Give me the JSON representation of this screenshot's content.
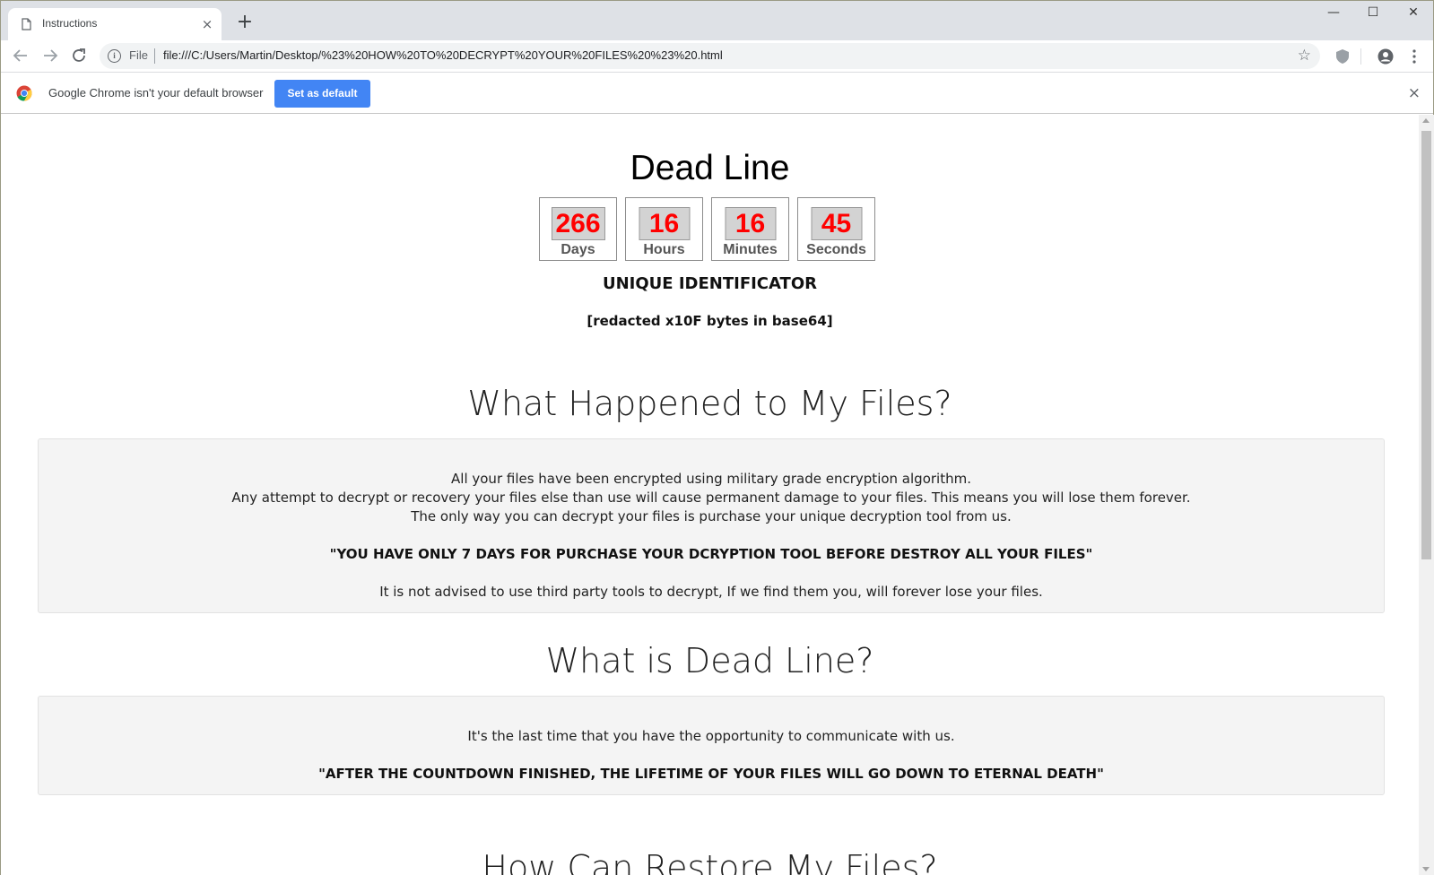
{
  "browser": {
    "tab_title": "Instructions",
    "tab_close": "×",
    "new_tab": "+",
    "window_controls": {
      "minimize": "—",
      "maximize": "☐",
      "close": "✕"
    },
    "omnibox": {
      "scheme_label": "File",
      "url": "file:///C:/Users/Martin/Desktop/%23%20HOW%20TO%20DECRYPT%20YOUR%20FILES%20%23%20.html"
    },
    "infobar": {
      "message": "Google Chrome isn't your default browser",
      "button_label": "Set as default",
      "close": "×"
    }
  },
  "page": {
    "title": "Dead Line",
    "countdown": [
      {
        "value": "266",
        "label": "Days"
      },
      {
        "value": "16",
        "label": "Hours"
      },
      {
        "value": "16",
        "label": "Minutes"
      },
      {
        "value": "45",
        "label": "Seconds"
      }
    ],
    "uid_title": "UNIQUE IDENTIFICATOR",
    "uid_value": "[redacted x10F bytes in base64]",
    "section1": {
      "heading": "What Happened to My Files?",
      "line1": "All your files have been encrypted using military grade encryption algorithm.",
      "line2": "Any attempt to decrypt or recovery your files else than use will cause permanent damage to your files. This means you will lose them forever.",
      "line3": "The only way you can decrypt your files is purchase your unique decryption tool from us.",
      "warning": "\"YOU HAVE ONLY 7 DAYS FOR PURCHASE YOUR DCRYPTION TOOL BEFORE DESTROY ALL YOUR FILES\"",
      "line4": "It is not advised to use third party tools to decrypt, If we find them you, will forever lose your files."
    },
    "section2": {
      "heading": "What is Dead Line?",
      "line1": "It's the last time that you have the opportunity to communicate with us.",
      "warning": "\"AFTER THE COUNTDOWN FINISHED, THE LIFETIME OF YOUR FILES WILL GO DOWN TO ETERNAL DEATH\""
    },
    "section3": {
      "heading": "How Can Restore My Files?"
    }
  },
  "colors": {
    "countdown_digits": "#ff0000",
    "infobar_button": "#4285f4",
    "panel_bg": "#f4f4f4"
  }
}
